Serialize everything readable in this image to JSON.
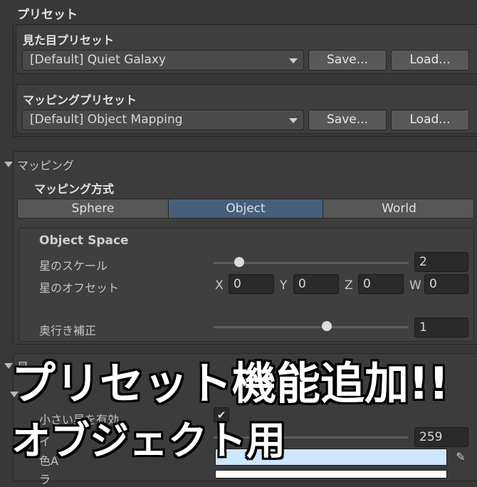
{
  "preset_section": {
    "title": "プリセット",
    "look": {
      "title": "見た目プリセット",
      "selected": "[Default] Quiet Galaxy",
      "save_label": "Save...",
      "load_label": "Load..."
    },
    "mapping": {
      "title": "マッピングプリセット",
      "selected": "[Default] Object Mapping",
      "save_label": "Save...",
      "load_label": "Load..."
    }
  },
  "mapping_section": {
    "title": "マッピング",
    "method_label": "マッピング方式",
    "methods": [
      "Sphere",
      "Object",
      "World"
    ],
    "selected_method": "Object",
    "object_space": {
      "title": "Object Space",
      "star_scale_label": "星のスケール",
      "star_scale_value": "2",
      "star_scale_fraction": 0.13,
      "star_offset_label": "星のオフセット",
      "offset": [
        {
          "axis": "X",
          "value": "0"
        },
        {
          "axis": "Y",
          "value": "0"
        },
        {
          "axis": "Z",
          "value": "0"
        },
        {
          "axis": "W",
          "value": "0"
        }
      ],
      "depth_label": "奥行き補正",
      "depth_value": "1",
      "depth_fraction": 0.58
    }
  },
  "lower_section": {
    "header_partial": "星",
    "sub_header_partial": "小",
    "small_star_label": "小さい星を有効",
    "small_star_checked": true,
    "count_value": "259",
    "count_label_partial": "イ",
    "color_label_partial": "色A",
    "color_field_hex": "#cfe6ff",
    "color2_field_hex": "#ffffff",
    "row_partial": "ラ"
  },
  "overlay": {
    "line1": "プリセット機能追加!!",
    "line2": "オブジェクト用"
  },
  "colors": {
    "background": "#383838",
    "accent_selected": "#46607c"
  }
}
